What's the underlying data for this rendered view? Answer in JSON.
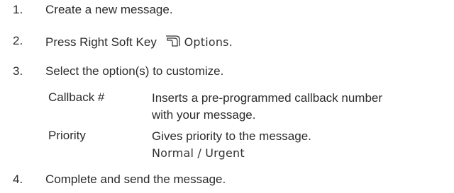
{
  "steps": [
    {
      "number": "1.",
      "text": "Create a new message."
    },
    {
      "number": "2.",
      "text_prefix": "Press Right Soft Key",
      "icon": "right-soft-key-icon",
      "ui_text": "Options."
    },
    {
      "number": "3.",
      "text": "Select the option(s) to customize."
    },
    {
      "number": "4.",
      "text": "Complete and send the message."
    }
  ],
  "options": [
    {
      "name": "Callback #",
      "description_line1": "Inserts a pre-programmed callback number",
      "description_line2": "with your message."
    },
    {
      "name": "Priority",
      "description_line1": "Gives priority to the message.",
      "values": "Normal / Urgent"
    }
  ]
}
